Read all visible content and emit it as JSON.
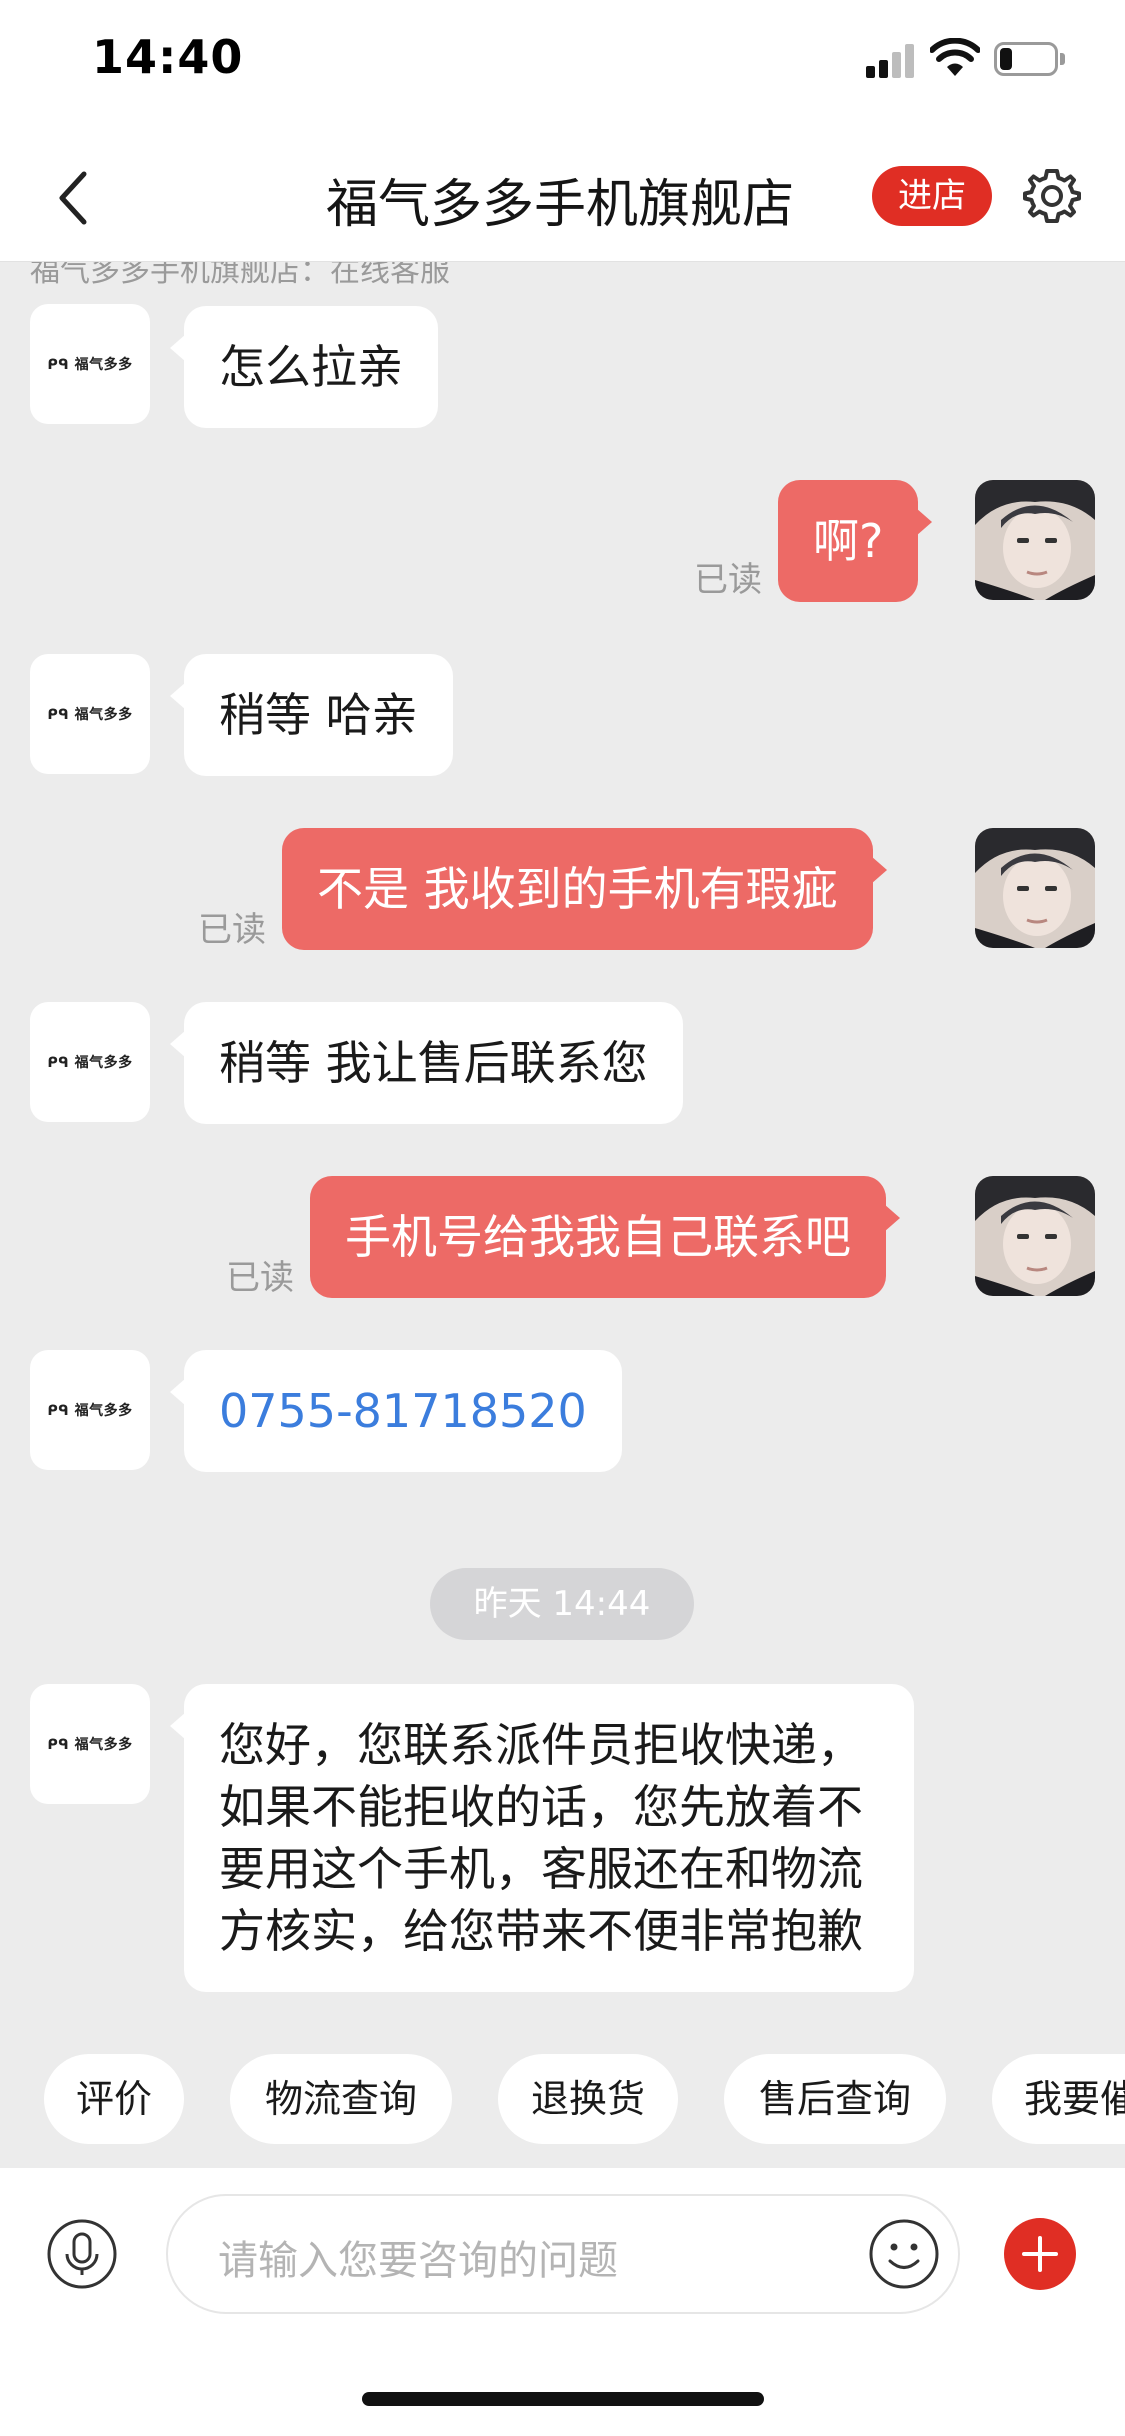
{
  "status_bar": {
    "time": "14:40"
  },
  "nav": {
    "title": "福气多多手机旗舰店",
    "enter_store_label": "进店",
    "back_icon": "chevron-left-icon",
    "settings_icon": "gear-icon"
  },
  "chat": {
    "cutoff_text": "福气多多手机旗舰店：在线客服",
    "shop_logo_text": "ᑭᑫ 福气多多",
    "read_label": "已读",
    "messages": [
      {
        "from": "shop",
        "text": "怎么拉亲"
      },
      {
        "from": "user",
        "text": "啊?"
      },
      {
        "from": "shop",
        "text": "稍等 哈亲"
      },
      {
        "from": "user",
        "text": "不是  我收到的手机有瑕疵"
      },
      {
        "from": "shop",
        "text": "稍等 我让售后联系您"
      },
      {
        "from": "user",
        "text": "手机号给我我自己联系吧"
      },
      {
        "from": "shop",
        "text": "0755-81718520"
      },
      {
        "from": "shop",
        "text": "您好，您联系派件员拒收快递，如果不能拒收的话，您先放着不要用这个手机，客服还在和物流方核实，给您带来不便非常抱歉"
      }
    ],
    "time_divider": "昨天 14:44"
  },
  "quick_replies": [
    "评价",
    "物流查询",
    "退换货",
    "售后查询",
    "我要催"
  ],
  "input": {
    "placeholder": "请输入您要咨询的问题",
    "mic_icon": "microphone-icon",
    "emoji_icon": "smiley-icon",
    "plus_icon": "plus-icon"
  },
  "colors": {
    "accent_red": "#e02e24",
    "outgoing_bubble": "#ed6a66",
    "link_blue": "#3b7ddd",
    "chat_background": "#ececec"
  }
}
